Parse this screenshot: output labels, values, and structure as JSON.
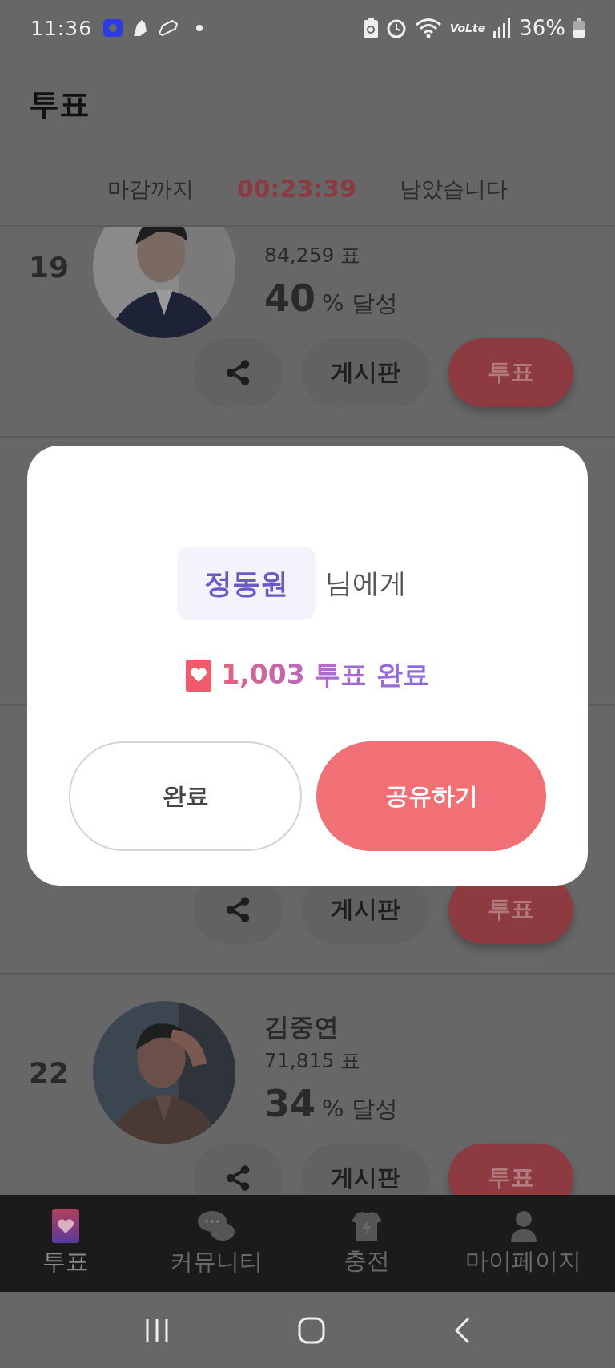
{
  "status_bar": {
    "time": "11:36",
    "network": "VoLte",
    "battery": "36%"
  },
  "header": {
    "title": "투표"
  },
  "countdown": {
    "prefix": "마감까지",
    "time": "00:23:39",
    "suffix": "남았습니다"
  },
  "candidates": [
    {
      "kind": "full",
      "rank": "19",
      "votes": "84,259 표",
      "percent": "40",
      "percent_label": "% 달성",
      "board": "게시판",
      "vote": "투표"
    },
    {
      "kind": "hidden"
    },
    {
      "kind": "buttons",
      "board": "게시판",
      "vote": "투표"
    },
    {
      "kind": "full",
      "rank": "22",
      "name": "김중연",
      "votes": "71,815 표",
      "percent": "34",
      "percent_label": "% 달성",
      "board": "게시판",
      "vote": "투표"
    }
  ],
  "dialog": {
    "recipient": "정동원",
    "recipient_suffix": "님에게",
    "result": "1,003 투표 완료",
    "buttons": [
      {
        "kind": "outline",
        "label": "완료"
      },
      {
        "kind": "primary",
        "label": "공유하기"
      }
    ]
  },
  "bottom_nav": [
    {
      "kind": "vote",
      "label": "투표",
      "selected": true
    },
    {
      "kind": "community",
      "label": "커뮤니티",
      "selected": false
    },
    {
      "kind": "charge",
      "label": "충전",
      "selected": false
    },
    {
      "kind": "mypage",
      "label": "마이페이지",
      "selected": false
    }
  ]
}
